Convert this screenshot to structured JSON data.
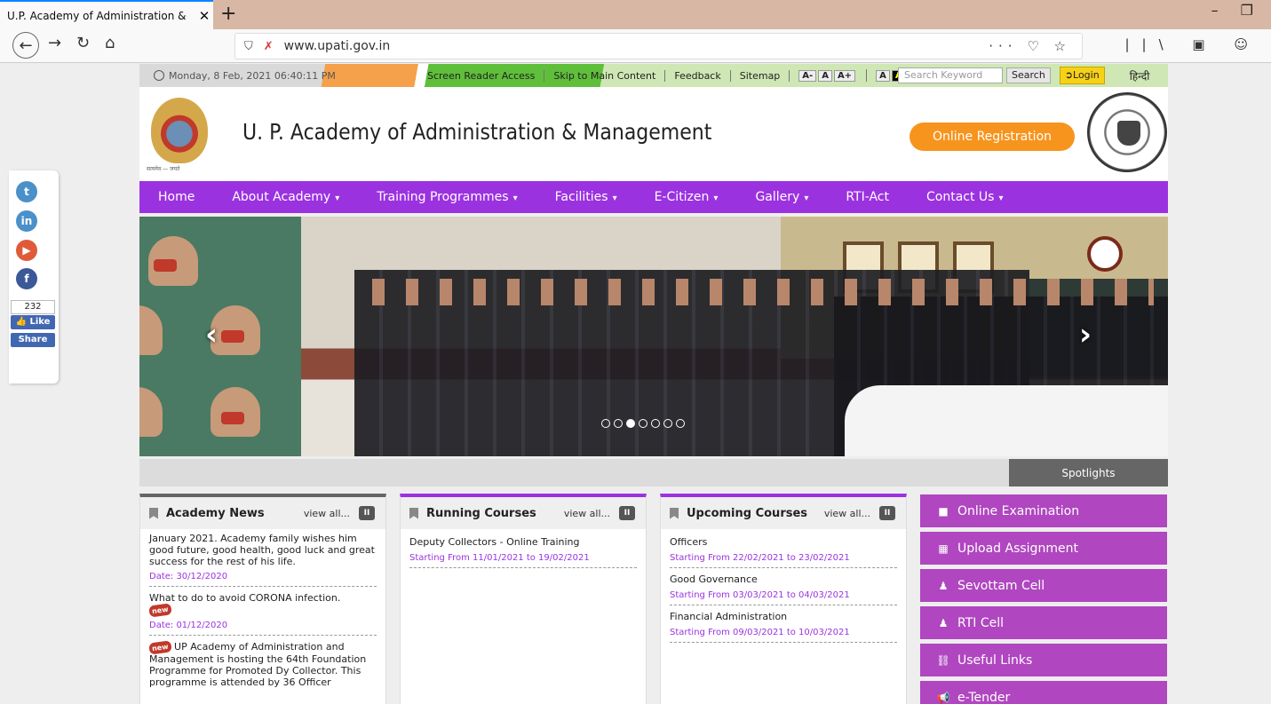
{
  "browser": {
    "tab_title": "U.P. Academy of Administration &",
    "tab_close": "✕",
    "new_tab": "+",
    "url": "www.upati.gov.in",
    "url_actions": "··· ♡ ☆",
    "window_controls": "– ❐",
    "toolbar_icons": "||\\ ▣ ☺"
  },
  "topstrip": {
    "datetime": "Monday, 8 Feb, 2021 06:40:11 PM",
    "links": [
      "Screen Reader Access",
      "Skip to Main Content",
      "Feedback",
      "Sitemap"
    ],
    "font_sizes": [
      "A-",
      "A",
      "A+"
    ],
    "contrast": [
      "A",
      "A"
    ],
    "search_placeholder": "Search Keyword",
    "search_button": "Search",
    "login": "Login",
    "hindi": "हिन्दी"
  },
  "header": {
    "logo_caption": "सत्यमेव — जयते",
    "title": "U. P. Academy of Administration & Management",
    "registration_button": "Online Registration"
  },
  "mainnav": [
    {
      "label": "Home",
      "caret": ""
    },
    {
      "label": "About Academy",
      "caret": "▾"
    },
    {
      "label": "Training Programmes",
      "caret": "▾"
    },
    {
      "label": "Facilities",
      "caret": "▾"
    },
    {
      "label": "E-Citizen",
      "caret": "▾"
    },
    {
      "label": "Gallery",
      "caret": "▾"
    },
    {
      "label": "RTI-Act",
      "caret": ""
    },
    {
      "label": "Contact Us",
      "caret": "▾"
    }
  ],
  "social": {
    "twitter": "t",
    "linkedin": "in",
    "youtube": "▶",
    "facebook": "f",
    "like_count": "232",
    "like": "Like",
    "share": "Share"
  },
  "slider": {
    "prev": "‹",
    "next": "›"
  },
  "spotlights": "Spotlights",
  "academy_news": {
    "title": "Academy News",
    "view_all": "view all...",
    "pause": "II",
    "items": [
      {
        "text": "January 2021. Academy family wishes him good future, good health, good luck and great success for the rest of his life.",
        "date": "Date: 30/12/2020"
      },
      {
        "text": "What to do to avoid CORONA infection.",
        "badge": "new",
        "date": "Date: 01/12/2020"
      },
      {
        "badge": "new",
        "text": "UP Academy of Administration and Management is hosting the 64th Foundation Programme for Promoted Dy Collector. This programme is attended by 36 Officer"
      }
    ]
  },
  "running_courses": {
    "title": "Running Courses",
    "view_all": "view all...",
    "pause": "II",
    "items": [
      {
        "title": "Deputy Collectors - Online Training",
        "dates": "Starting From 11/01/2021 to 19/02/2021"
      }
    ]
  },
  "upcoming_courses": {
    "title": "Upcoming Courses",
    "view_all": "view all...",
    "pause": "II",
    "items": [
      {
        "title": "Officers",
        "dates": "Starting From 22/02/2021 to 23/02/2021"
      },
      {
        "title": "Good Governance",
        "dates": "Starting From 03/03/2021 to 04/03/2021"
      },
      {
        "title": "Financial Administration",
        "dates": "Starting From 09/03/2021 to 10/03/2021"
      }
    ]
  },
  "side_buttons": [
    {
      "icon": "■",
      "label": "Online Examination"
    },
    {
      "icon": "▦",
      "label": "Upload Assignment"
    },
    {
      "icon": "♟",
      "label": "Sevottam Cell"
    },
    {
      "icon": "♟",
      "label": "RTI Cell"
    },
    {
      "icon": "⛓",
      "label": "Useful Links"
    },
    {
      "icon": "📢",
      "label": "e-Tender"
    }
  ]
}
